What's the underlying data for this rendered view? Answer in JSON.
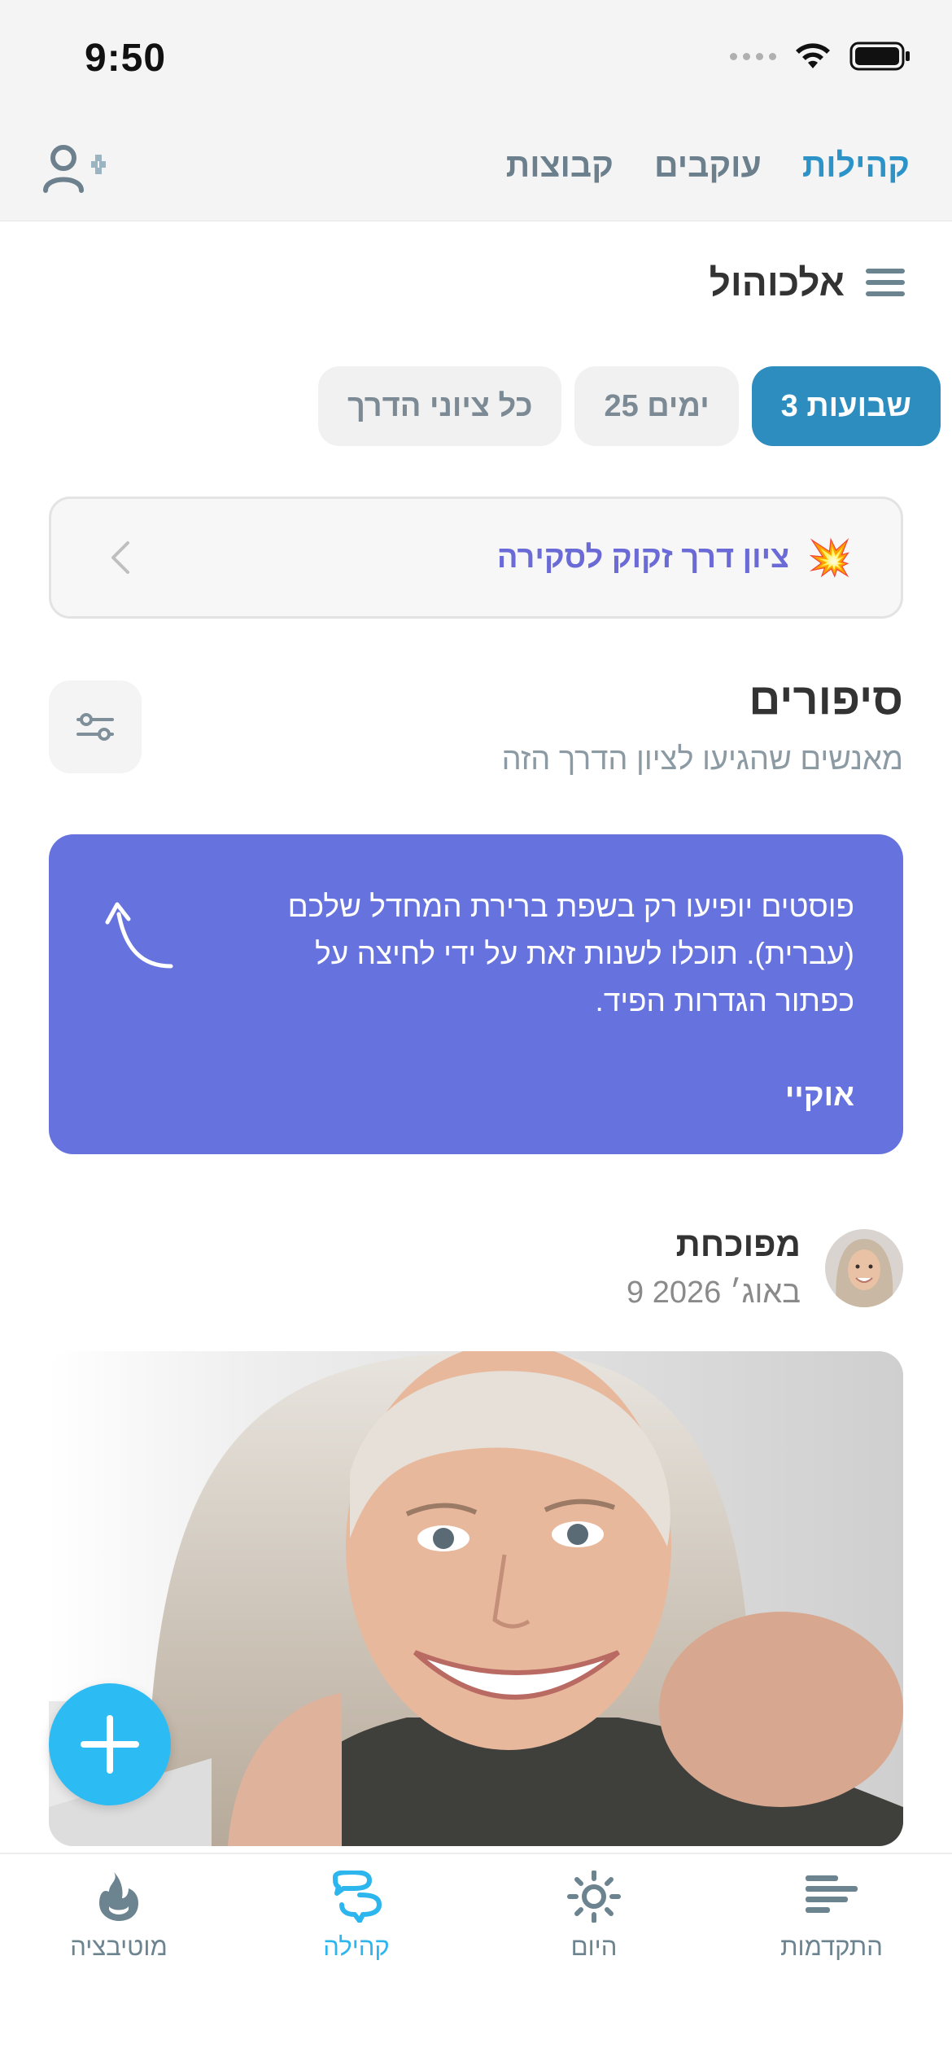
{
  "status_bar": {
    "time": "9:50"
  },
  "nav": {
    "tabs": [
      {
        "label": "קהילות",
        "active": true
      },
      {
        "label": "עוקבים",
        "active": false
      },
      {
        "label": "קבוצות",
        "active": false
      }
    ],
    "add_friend_icon": "person-add-icon"
  },
  "addiction": {
    "title": "אלכוהול",
    "menu_icon": "hamburger-icon"
  },
  "chips": [
    {
      "label": "3 שבועות",
      "active": true
    },
    {
      "label": "25 ימים",
      "active": false
    },
    {
      "label": "כל ציוני הדרך",
      "active": false
    }
  ],
  "milestone_banner": {
    "emoji": "💥",
    "text": "ציון דרך זקוק לסקירה"
  },
  "stories": {
    "title": "סיפורים",
    "subtitle": "מאנשים שהגיעו לציון הדרך הזה"
  },
  "info_card": {
    "text": "פוסטים יופיעו רק בשפת ברירת המחדל שלכם (עברית). תוכלו לשנות זאת על ידי לחיצה על כפתור הגדרות הפיד.",
    "ok_label": "אוקיי"
  },
  "post": {
    "author": "מפוכחת",
    "date": "9 באוג׳ 2026"
  },
  "tabbar": [
    {
      "label": "התקדמות",
      "icon": "progress-bars-icon",
      "active": false
    },
    {
      "label": "היום",
      "icon": "sun-icon",
      "active": false
    },
    {
      "label": "קהילה",
      "icon": "chat-bubbles-icon",
      "active": true
    },
    {
      "label": "מוטיבציה",
      "icon": "flame-icon",
      "active": false
    }
  ],
  "colors": {
    "accent": "#2b93c8",
    "chip_active": "#2d8dbf",
    "info_card": "#6673de",
    "fab": "#2dbbf3",
    "milestone_text": "#6a6bd6"
  }
}
